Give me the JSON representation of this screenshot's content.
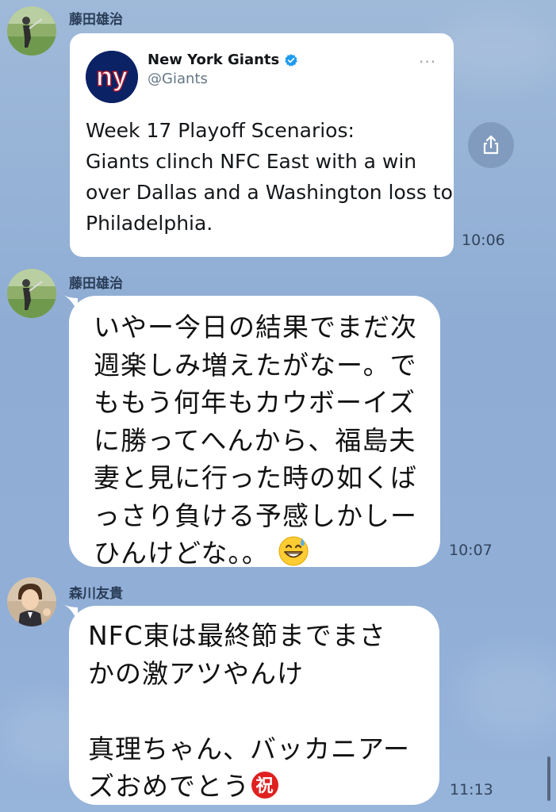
{
  "colors": {
    "background": "#94b1d8",
    "bubble": "#ffffff",
    "giants_blue": "#0b2265",
    "giants_red": "#a71930",
    "verified_blue": "#1d9bf0"
  },
  "messages": [
    {
      "sender": "藤田雄治",
      "type": "tweet",
      "time": "10:06",
      "tweet": {
        "account_name": "New York Giants",
        "handle": "@Giants",
        "logo_text": "ny",
        "more_label": "···",
        "lines": [
          "Week 17 Playoff Scenarios:",
          "Giants clinch NFC East with a win",
          "over Dallas and a Washington loss to",
          "Philadelphia."
        ]
      }
    },
    {
      "sender": "藤田雄治",
      "type": "text",
      "time": "10:07",
      "lines": [
        "いやー今日の結果でまだ次",
        "週楽しみ増えたがなー。で",
        "ももう何年もカウボーイズ",
        "に勝ってへんから、福島夫",
        "妻と見に行った時の如くば",
        "っさり負ける予感しかしー",
        "ひんけどな。。"
      ],
      "emoji": "grinning-sweat"
    },
    {
      "sender": "森川友貴",
      "type": "text",
      "time": "11:13",
      "lines": [
        "NFC東は最終節までまさ",
        "かの激アツやんけ",
        "",
        "真理ちゃん、バッカニアー",
        "ズおめでとう"
      ],
      "emoji": "祝"
    }
  ]
}
